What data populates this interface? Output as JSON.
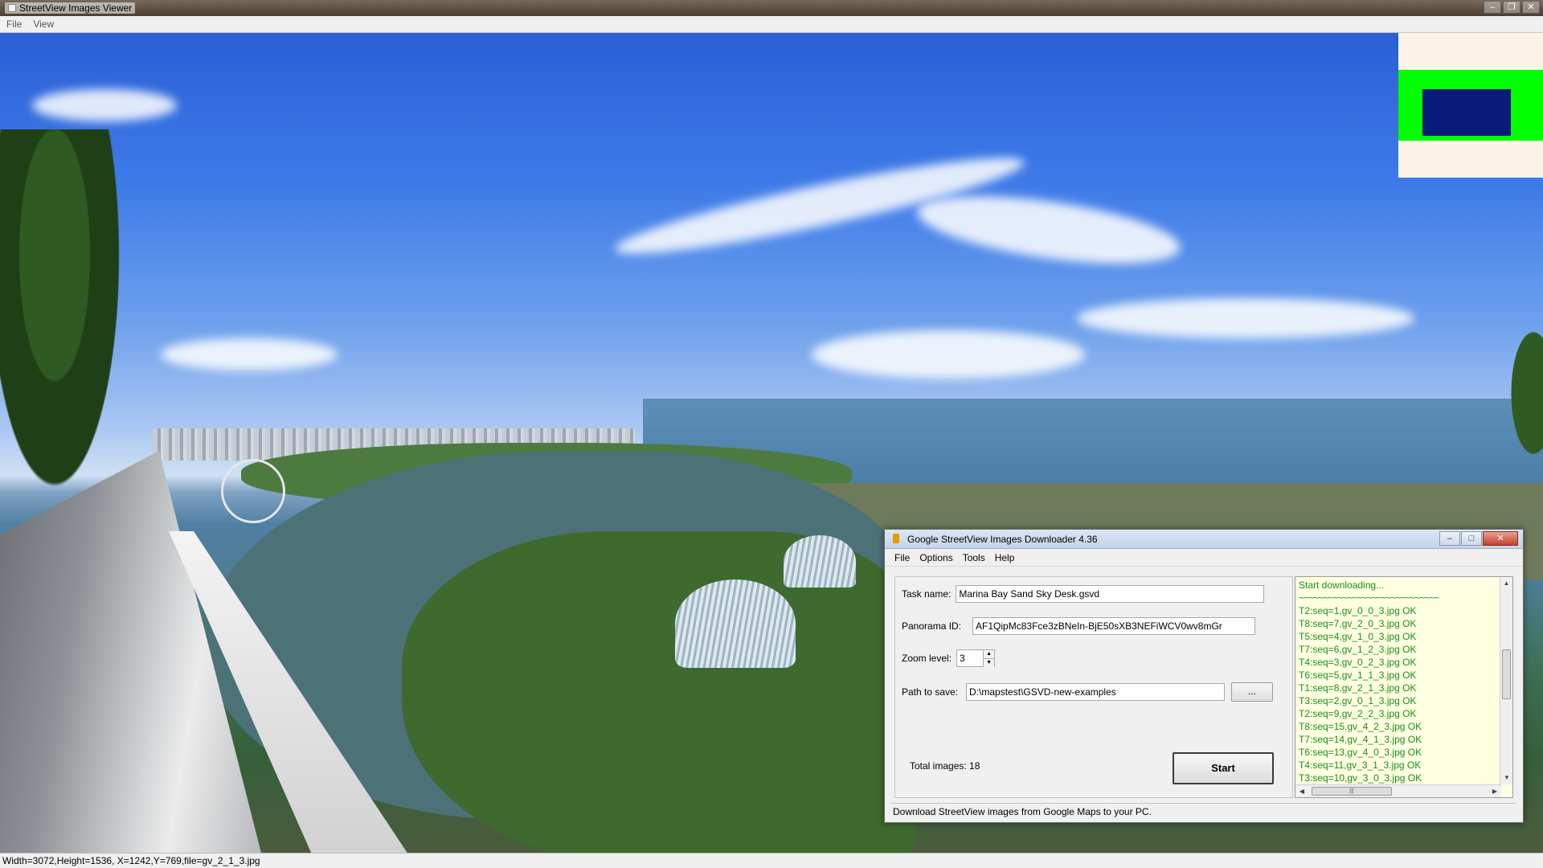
{
  "viewer": {
    "title": "StreetView Images Viewer",
    "menu": [
      "File",
      "View"
    ],
    "status": "Width=3072,Height=1536, X=1242,Y=769,file=gv_2_1_3.jpg"
  },
  "minimap": {
    "colors": {
      "background": "#fbf4e6",
      "band": "#00ff00",
      "view": "#0a1a7a"
    }
  },
  "dialog": {
    "title": "Google StreetView Images Downloader 4.36",
    "menu": [
      "File",
      "Options",
      "Tools",
      "Help"
    ],
    "task_label": "Task name:",
    "task_value": "Marina Bay Sand Sky Desk.gsvd",
    "pano_label": "Panorama ID:",
    "pano_value": "AF1QipMc83Fce3zBNeIn-BjE50sXB3NEFiWCV0wv8mGr",
    "zoom_label": "Zoom level:",
    "zoom_value": "3",
    "path_label": "Path to save:",
    "path_value": "D:\\mapstest\\GSVD-new-examples",
    "browse_label": "...",
    "total_label": "Total images: 18",
    "start_label": "Start",
    "status": "Download StreetView images from Google Maps to your PC.",
    "log": [
      "Start downloading...",
      "~~~~~~~~~~~~~~~~~~~~~~~~~~~~~",
      "T2:seq=1,gv_0_0_3.jpg OK",
      "T8:seq=7,gv_2_0_3.jpg OK",
      "T5:seq=4,gv_1_0_3.jpg OK",
      "T7:seq=6,gv_1_2_3.jpg OK",
      "T4:seq=3,gv_0_2_3.jpg OK",
      "T6:seq=5,gv_1_1_3.jpg OK",
      "T1:seq=8,gv_2_1_3.jpg OK",
      "T3:seq=2,gv_0_1_3.jpg OK",
      "T2:seq=9,gv_2_2_3.jpg OK",
      "T8:seq=15,gv_4_2_3.jpg OK",
      "T7:seq=14,gv_4_1_3.jpg OK",
      "T6:seq=13,gv_4_0_3.jpg OK",
      "T4:seq=11,gv_3_1_3.jpg OK",
      "T3:seq=10,gv_3_0_3.jpg OK"
    ]
  }
}
